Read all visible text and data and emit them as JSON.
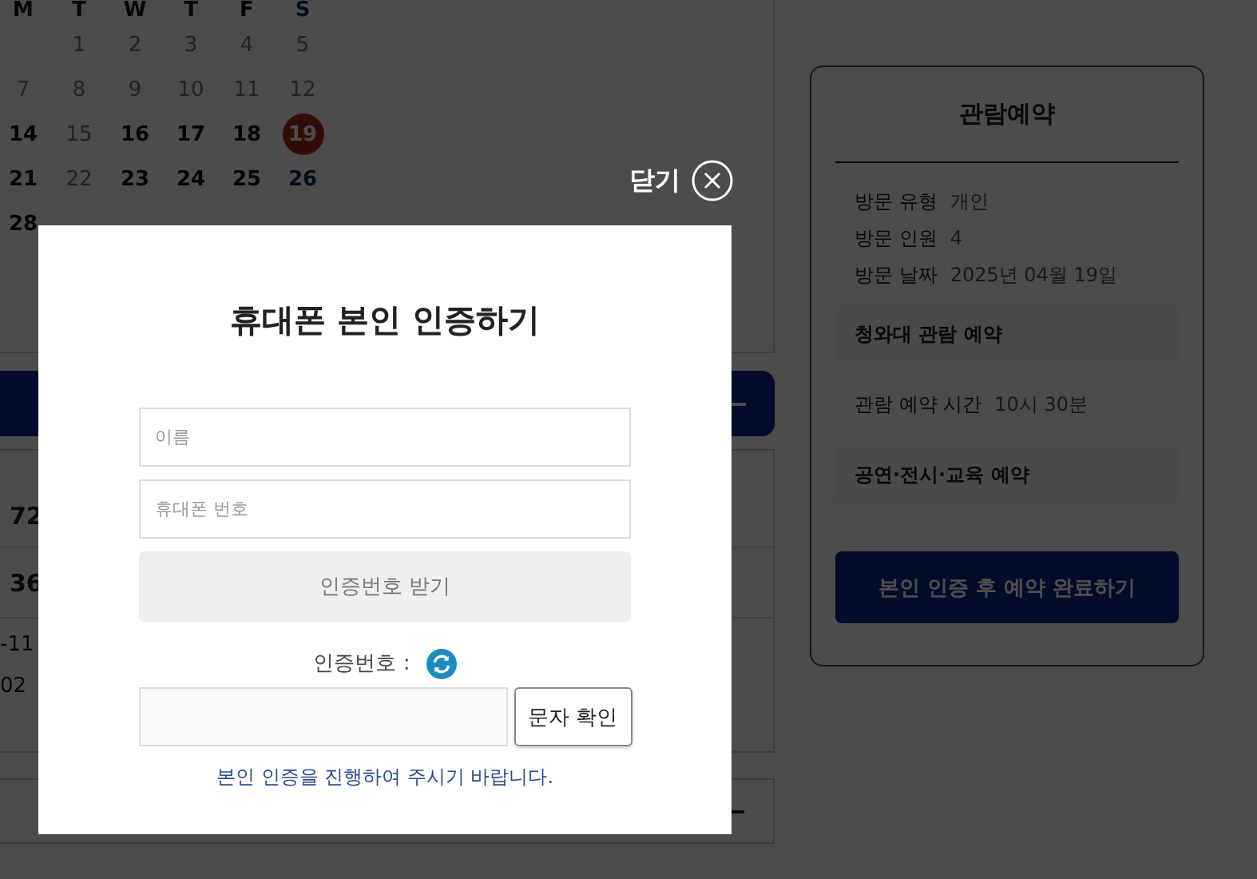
{
  "calendar": {
    "weekdays": [
      {
        "label": "M",
        "kind": "weekday"
      },
      {
        "label": "T",
        "kind": "weekday"
      },
      {
        "label": "W",
        "kind": "weekday"
      },
      {
        "label": "T",
        "kind": "weekday"
      },
      {
        "label": "F",
        "kind": "weekday"
      },
      {
        "label": "S",
        "kind": "saturday"
      }
    ],
    "weeks": [
      [
        {
          "kind": "empty"
        },
        {
          "label": "1",
          "kind": "day",
          "disabled": true,
          "selected": false
        },
        {
          "label": "2",
          "kind": "day",
          "disabled": true,
          "selected": false
        },
        {
          "label": "3",
          "kind": "day",
          "disabled": true,
          "selected": false
        },
        {
          "label": "4",
          "kind": "day",
          "disabled": true,
          "selected": false
        },
        {
          "label": "5",
          "kind": "saturday",
          "disabled": true,
          "selected": false
        }
      ],
      [
        {
          "label": "7",
          "kind": "day",
          "disabled": true,
          "selected": false
        },
        {
          "label": "8",
          "kind": "day",
          "disabled": true,
          "selected": false
        },
        {
          "label": "9",
          "kind": "day",
          "disabled": true,
          "selected": false
        },
        {
          "label": "10",
          "kind": "day",
          "disabled": true,
          "selected": false
        },
        {
          "label": "11",
          "kind": "day",
          "disabled": true,
          "selected": false
        },
        {
          "label": "12",
          "kind": "saturday",
          "disabled": true,
          "selected": false
        }
      ],
      [
        {
          "label": "14",
          "kind": "day",
          "disabled": false,
          "selected": false
        },
        {
          "label": "15",
          "kind": "day",
          "disabled": true,
          "selected": false
        },
        {
          "label": "16",
          "kind": "day",
          "disabled": false,
          "selected": false
        },
        {
          "label": "17",
          "kind": "day",
          "disabled": false,
          "selected": false
        },
        {
          "label": "18",
          "kind": "day",
          "disabled": false,
          "selected": false
        },
        {
          "label": "19",
          "kind": "saturday",
          "disabled": false,
          "selected": true
        }
      ],
      [
        {
          "label": "21",
          "kind": "day",
          "disabled": false,
          "selected": false
        },
        {
          "label": "22",
          "kind": "day",
          "disabled": true,
          "selected": false
        },
        {
          "label": "23",
          "kind": "day",
          "disabled": false,
          "selected": false
        },
        {
          "label": "24",
          "kind": "day",
          "disabled": false,
          "selected": false
        },
        {
          "label": "25",
          "kind": "day",
          "disabled": false,
          "selected": false
        },
        {
          "label": "26",
          "kind": "saturday",
          "disabled": false,
          "selected": false
        }
      ],
      [
        {
          "label": "28",
          "kind": "day",
          "disabled": false,
          "selected": false
        }
      ]
    ]
  },
  "list_rows": [
    "72",
    "36"
  ],
  "list_notes": [
    "-11",
    "02"
  ],
  "reservation": {
    "title": "관람예약",
    "details": [
      {
        "label": "방문 유형",
        "value": "개인"
      },
      {
        "label": "방문 인원",
        "value": "4"
      },
      {
        "label": "방문 날짜",
        "value": "2025년 04월 19일"
      }
    ],
    "sections": [
      {
        "kind": "panel",
        "label": "청와대 관람 예약"
      },
      {
        "kind": "row",
        "label": "관람 예약 시간",
        "value": "10시 30분"
      },
      {
        "kind": "panel",
        "label": "공연·전시·교육 예약"
      }
    ],
    "submit": "본인 인증 후 예약 완료하기"
  },
  "modal": {
    "close": "닫기",
    "title": "휴대폰 본인 인증하기",
    "name_field": {
      "placeholder": "이름"
    },
    "phone_field": {
      "placeholder": "휴대폰 번호"
    },
    "request_button": "인증번호 받기",
    "code_label": "인증번호 :",
    "confirm_button": "문자 확인",
    "notice": "본인 인증을 진행하여 주시기 바랍니다."
  }
}
